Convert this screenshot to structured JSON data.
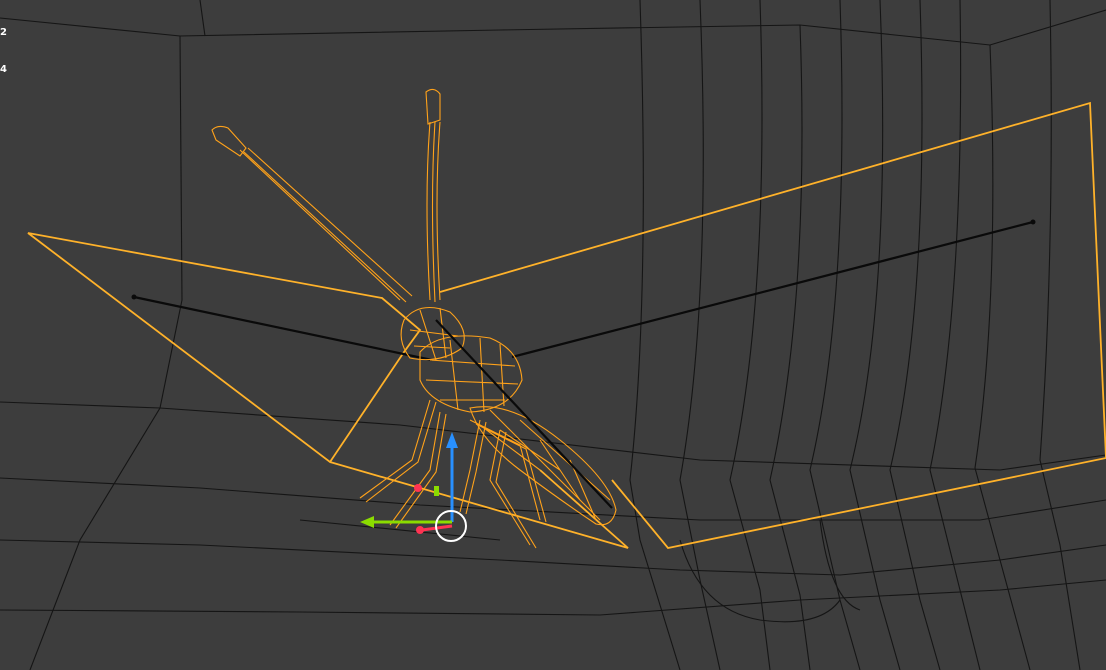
{
  "viewport": {
    "background": "#3d3d3d",
    "selection_color": "#ffb22a",
    "overlay_numbers": [
      "2",
      "4"
    ]
  },
  "gizmo": {
    "x_axis_color": "#ff3352",
    "y_axis_color": "#8bdc00",
    "z_axis_color": "#2890ff",
    "cursor_color": "#ffffff"
  },
  "scene": {
    "selected_object": "insect-wireframe",
    "icons": [
      "transform-gizmo-icon",
      "3d-cursor-icon"
    ]
  }
}
